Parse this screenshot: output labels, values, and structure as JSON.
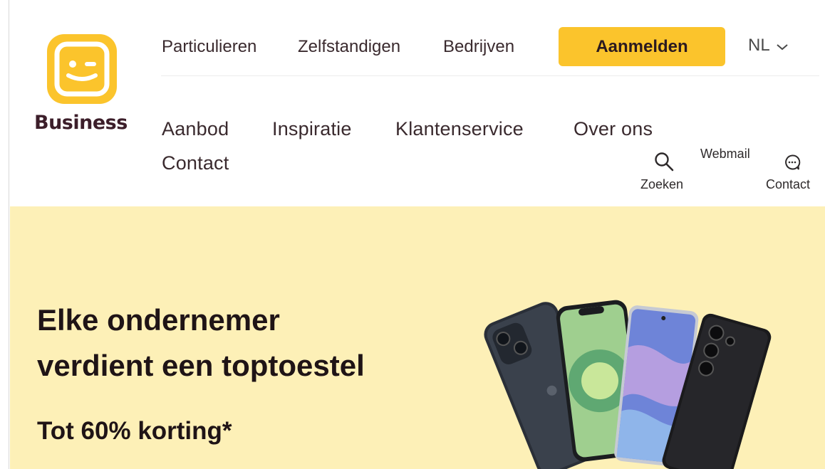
{
  "brand": {
    "logo_label": "Business",
    "colors": {
      "primary": "#fbc42c",
      "dark": "#3c1e2a",
      "hero_bg": "#fdf0b7"
    }
  },
  "top_nav": {
    "links": [
      "Particulieren",
      "Zelfstandigen",
      "Bedrijven"
    ],
    "login_label": "Aanmelden",
    "language": "NL"
  },
  "main_nav": {
    "items": [
      "Aanbod",
      "Inspiratie",
      "Klantenservice",
      "Over ons",
      "Contact"
    ]
  },
  "utilities": {
    "search_label": "Zoeken",
    "webmail_label": "Webmail",
    "contact_label": "Contact"
  },
  "hero": {
    "title_line1": "Elke ondernemer",
    "title_line2": "verdient een toptoestel",
    "subtitle": "Tot 60% korting*"
  }
}
